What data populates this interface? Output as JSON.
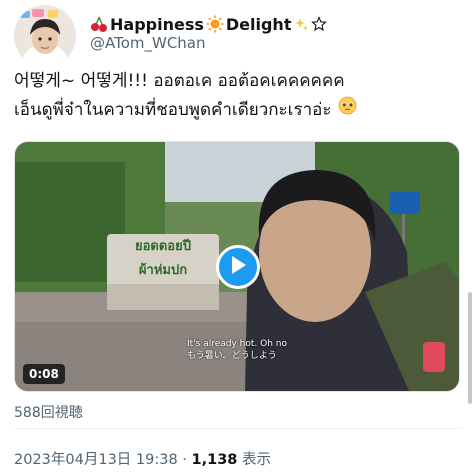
{
  "author": {
    "display_name": "Happiness",
    "display_name_2": "Delight",
    "handle": "@ATom_WChan",
    "badge_icon": "star-outline-icon"
  },
  "tweet": {
    "line1": "어떻게~ 어떻게!!! ออตอเค ออต้อคเคคคคคค",
    "line2": "เอ็นดูพี่จ๋าในความที่ชอบพูดคำเดียวกะเราอ่ะ",
    "emoji": "pleading-face-icon"
  },
  "media": {
    "duration": "0:08",
    "caption_en": "It's already hot. Oh no",
    "caption_jp": "もう暑い。どうしよう",
    "sign_text_1": "ยอดดอยปี",
    "sign_text_2": "ผ้าห่มปก",
    "play_color": "#1d9bf0"
  },
  "stats": {
    "views": "588回視聴",
    "date_time": "2023年04月13日 19:38 ·",
    "view_count": "1,138",
    "view_suffix": "表示"
  }
}
